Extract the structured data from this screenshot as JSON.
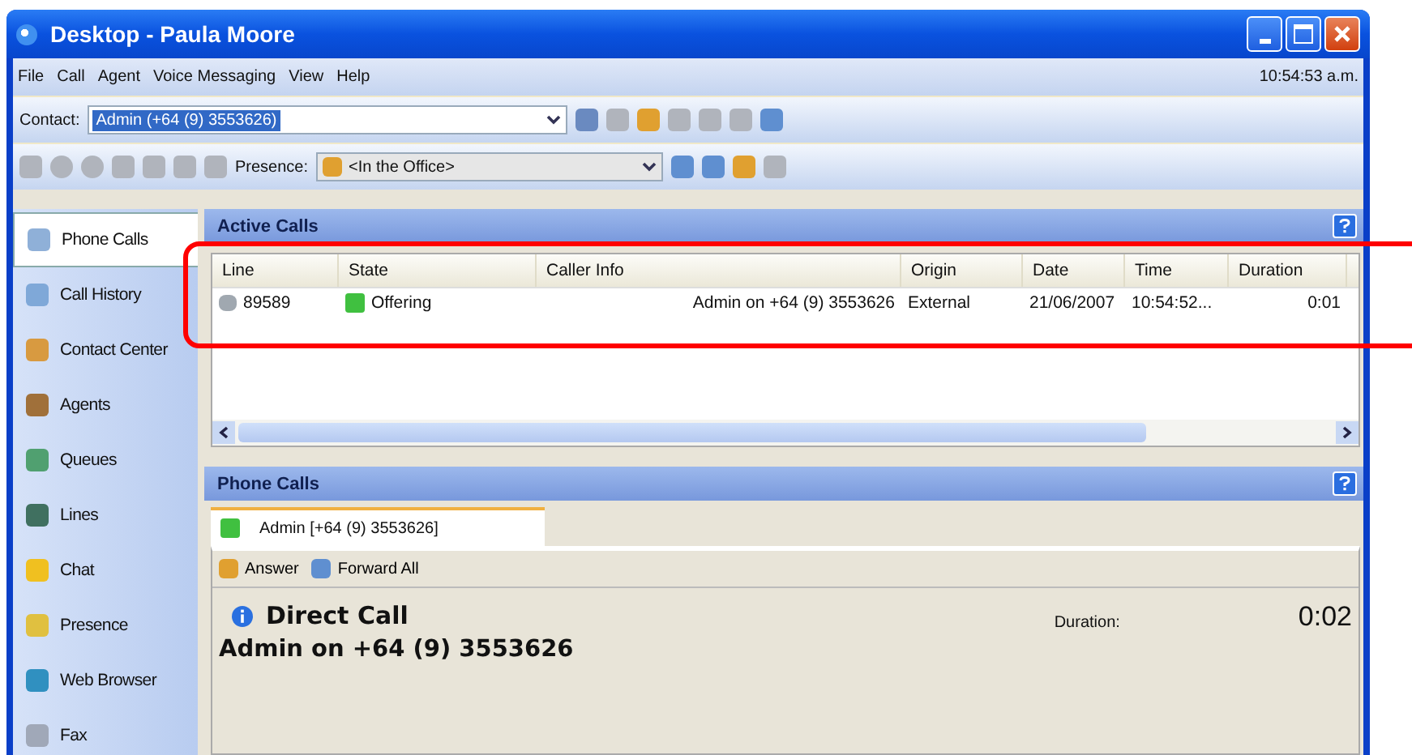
{
  "window": {
    "title": "Desktop - Paula Moore"
  },
  "menu": [
    "File",
    "Call",
    "Agent",
    "Voice Messaging",
    "View",
    "Help"
  ],
  "clock": "10:54:53 a.m.",
  "contact_bar": {
    "label": "Contact:",
    "value": "Admin (+64 (9) 3553626)"
  },
  "presence_bar": {
    "label": "Presence:",
    "value": "<In the Office>"
  },
  "sidebar": {
    "items": [
      {
        "label": "Phone Calls",
        "selected": true
      },
      {
        "label": "Call History",
        "selected": false
      },
      {
        "label": "Contact Center",
        "selected": false
      },
      {
        "label": "Agents",
        "selected": false
      },
      {
        "label": "Queues",
        "selected": false
      },
      {
        "label": "Lines",
        "selected": false
      },
      {
        "label": "Chat",
        "selected": false
      },
      {
        "label": "Presence",
        "selected": false
      },
      {
        "label": "Web Browser",
        "selected": false
      },
      {
        "label": "Fax",
        "selected": false
      }
    ]
  },
  "active_calls": {
    "title": "Active Calls",
    "table": {
      "columns": [
        "Line",
        "State",
        "Caller Info",
        "Origin",
        "Date",
        "Time",
        "Duration"
      ],
      "rows": [
        {
          "line": "89589",
          "state": "Offering",
          "caller_info": "Admin on +64 (9) 3553626",
          "origin": "External",
          "date": "21/06/2007",
          "time": "10:54:52...",
          "duration": "0:01"
        }
      ]
    }
  },
  "phone_calls": {
    "title": "Phone Calls",
    "tabs": [
      {
        "label": "Admin [+64 (9) 3553626]",
        "selected": true
      }
    ],
    "actions": [
      "Answer",
      "Forward All"
    ],
    "call_type": "Direct Call",
    "caller": "Admin on +64 (9) 3553626",
    "duration_label": "Duration:",
    "duration": "0:02"
  }
}
